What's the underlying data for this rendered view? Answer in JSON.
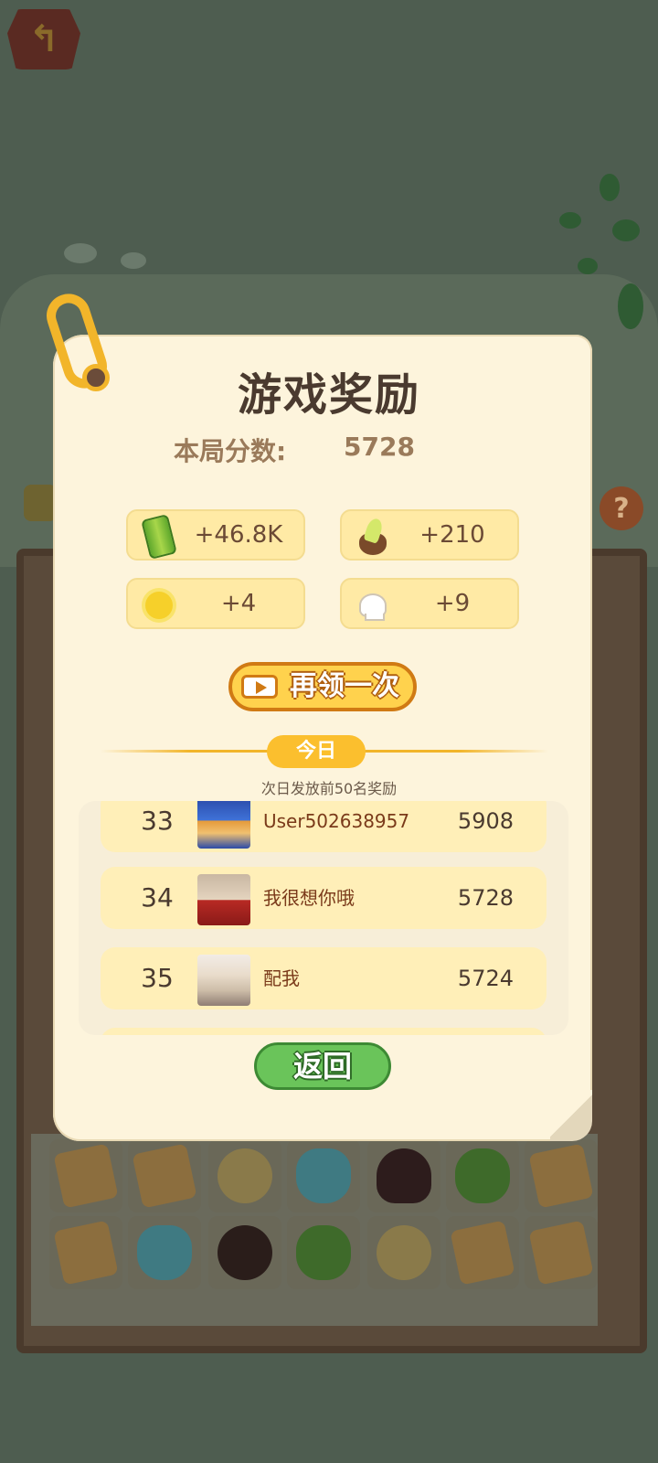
{
  "modal": {
    "title": "游戏奖励",
    "score_label": "本局分数:",
    "score_value": "5728",
    "rewards": [
      {
        "icon": "bamboo-icon",
        "value": "+46.8K"
      },
      {
        "icon": "bamboo-shoot-icon",
        "value": "+210"
      },
      {
        "icon": "flower-icon",
        "value": "+4"
      },
      {
        "icon": "chef-hat-icon",
        "value": "+9"
      }
    ],
    "again_button": "再领一次",
    "today_tab": "今日",
    "note": "次日发放前50名奖励",
    "ranking": [
      {
        "rank": "33",
        "name": "User502638957",
        "score": "5908"
      },
      {
        "rank": "34",
        "name": "我很想你哦",
        "score": "5728"
      },
      {
        "rank": "35",
        "name": "配我",
        "score": "5724"
      }
    ],
    "return_button": "返回"
  },
  "colors": {
    "accent_orange": "#f2b52a",
    "button_green": "#6ac45a",
    "reward_bg": "#ffeaa5",
    "panel_bg": "#fdf4dc"
  }
}
